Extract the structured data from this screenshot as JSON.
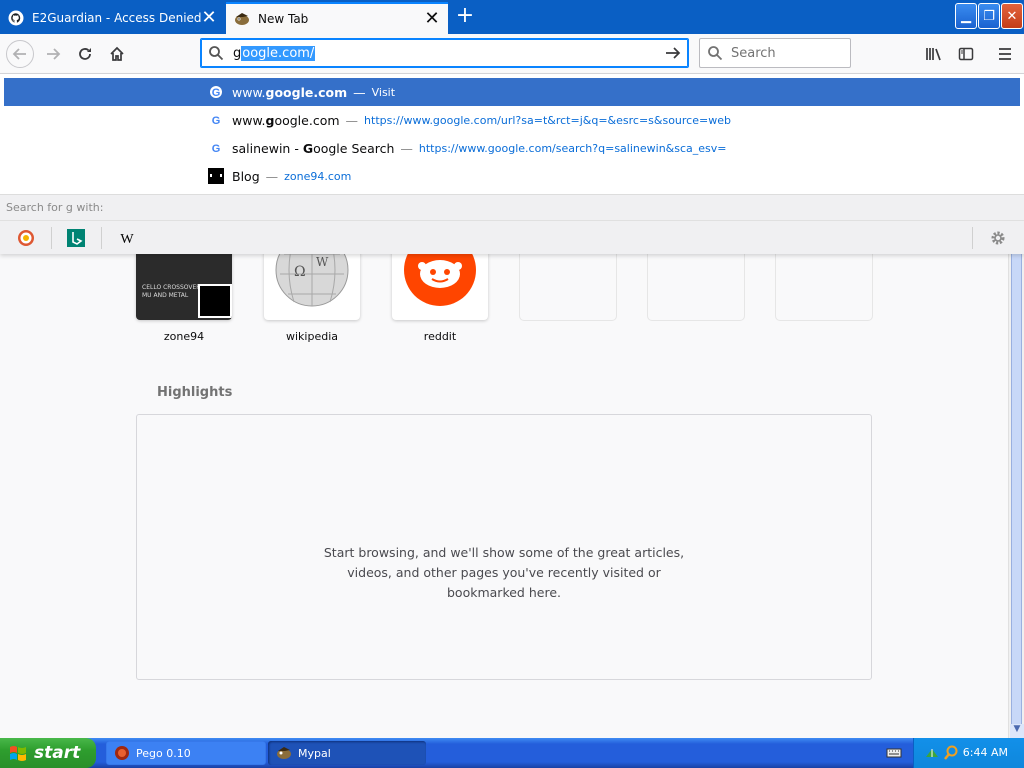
{
  "tabs": [
    {
      "title": "E2Guardian - Access Denied",
      "icon": "github-icon"
    },
    {
      "title": "New Tab",
      "icon": "firefox-icon"
    }
  ],
  "urlbar": {
    "typed": "g",
    "selected": "oogle.com/"
  },
  "searchbar": {
    "placeholder": "Search"
  },
  "suggestions": [
    {
      "pre": "www.",
      "bold": "g",
      "post": "oogle.com",
      "action": "Visit"
    },
    {
      "pre": "www.",
      "bold": "g",
      "post": "oogle.com",
      "url": "https://www.google.com/url?sa=t&rct=j&q=&esrc=s&source=web"
    },
    {
      "pre": "salinewin - ",
      "bold": "G",
      "post": "oogle Search",
      "url": "https://www.google.com/search?q=salinewin&sca_esv="
    },
    {
      "pre": "Blog",
      "bold": "",
      "post": "",
      "url": "zone94.com"
    }
  ],
  "search_with": "Search for g with:",
  "search_engines": [
    "duckduckgo-icon",
    "bing-icon",
    "wikipedia-icon"
  ],
  "top_sites": [
    {
      "label": "zone94",
      "thumb_text": "CELLO CROSSOVER MU AND METAL"
    },
    {
      "label": "wikipedia"
    },
    {
      "label": "reddit"
    }
  ],
  "highlights": {
    "title": "Highlights",
    "line1": "Start browsing, and we'll show some of the great articles,",
    "line2": "videos, and other pages you've recently visited or",
    "line3": "bookmarked here."
  },
  "taskbar": {
    "start": "start",
    "tasks": [
      {
        "label": "Pego 0.10"
      },
      {
        "label": "Mypal"
      }
    ],
    "time": "6:44 AM"
  },
  "colors": {
    "accent": "#0a84ff",
    "selection": "#3570c9",
    "titlebar": "#0a5fc4",
    "reddit": "#ff4500"
  }
}
